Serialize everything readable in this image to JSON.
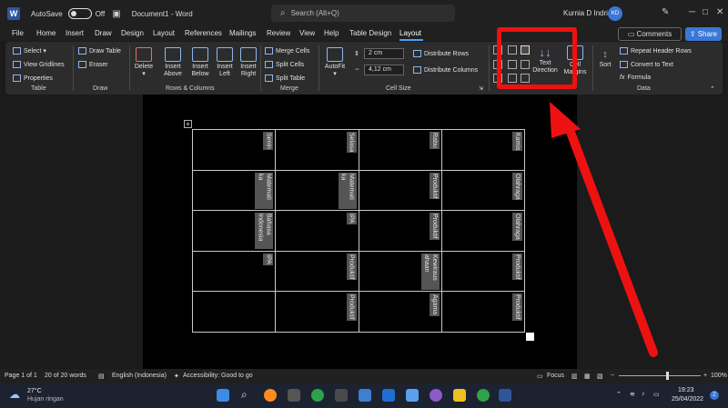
{
  "titlebar": {
    "autosave_label": "AutoSave",
    "autosave_state": "Off",
    "document_title": "Document1 - Word",
    "search_placeholder": "Search (Alt+Q)",
    "user_name": "Kurnia D Indri",
    "user_initials": "KD"
  },
  "menu": {
    "items": [
      "File",
      "Home",
      "Insert",
      "Draw",
      "Design",
      "Layout",
      "References",
      "Mailings",
      "Review",
      "View",
      "Help",
      "Table Design",
      "Layout"
    ],
    "active_index": 12,
    "comments_label": "Comments",
    "share_label": "Share"
  },
  "ribbon": {
    "table_group": {
      "label": "Table",
      "select": "Select",
      "view_gridlines": "View Gridlines",
      "properties": "Properties"
    },
    "draw_group": {
      "label": "Draw",
      "draw_table": "Draw Table",
      "eraser": "Eraser"
    },
    "rows_cols_group": {
      "label": "Rows & Columns",
      "delete": "Delete",
      "insert_above": [
        "Insert",
        "Above"
      ],
      "insert_below": [
        "Insert",
        "Below"
      ],
      "insert_left": [
        "Insert",
        "Left"
      ],
      "insert_right": [
        "Insert",
        "Right"
      ]
    },
    "merge_group": {
      "label": "Merge",
      "merge_cells": "Merge Cells",
      "split_cells": "Split Cells",
      "split_table": "Split Table"
    },
    "cell_size_group": {
      "label": "Cell Size",
      "autofit": "AutoFit",
      "height": "2 cm",
      "width": "4,12 cm",
      "distribute_rows": "Distribute Rows",
      "distribute_columns": "Distribute Columns"
    },
    "alignment_group": {
      "text_direction": [
        "Text",
        "Direction"
      ],
      "cell_margins": [
        "Cell",
        "Margins"
      ]
    },
    "data_group": {
      "label": "Data",
      "sort": "Sort",
      "repeat_header_rows": "Repeat Header Rows",
      "convert_to_text": "Convert to Text",
      "formula": "Formula"
    }
  },
  "table": {
    "rows": [
      [
        "Senin",
        "Selasa",
        "Rabu",
        "Kamis"
      ],
      [
        "Matemati ka",
        "Matemati ka",
        "Produktif",
        "Olahraga"
      ],
      [
        "Bahasa Indonesia",
        "IPA",
        "Produktif",
        "Olahraga"
      ],
      [
        "IPA",
        "Produktif",
        "Kewiraus ahaan",
        "Produktif"
      ],
      [
        "",
        "Produktif",
        "Agama",
        "Produktif"
      ]
    ]
  },
  "status": {
    "page": "Page 1 of 1",
    "words": "20 of 20 words",
    "language": "English (Indonesia)",
    "accessibility": "Accessibility: Good to go",
    "focus": "Focus",
    "zoom": "100%"
  },
  "taskbar": {
    "temperature": "27°C",
    "weather": "Hujan ringan",
    "time": "19:23",
    "date": "25/04/2022",
    "badge": "2"
  },
  "colors": {
    "highlight": "#ee1111",
    "accent": "#3a78d6"
  }
}
